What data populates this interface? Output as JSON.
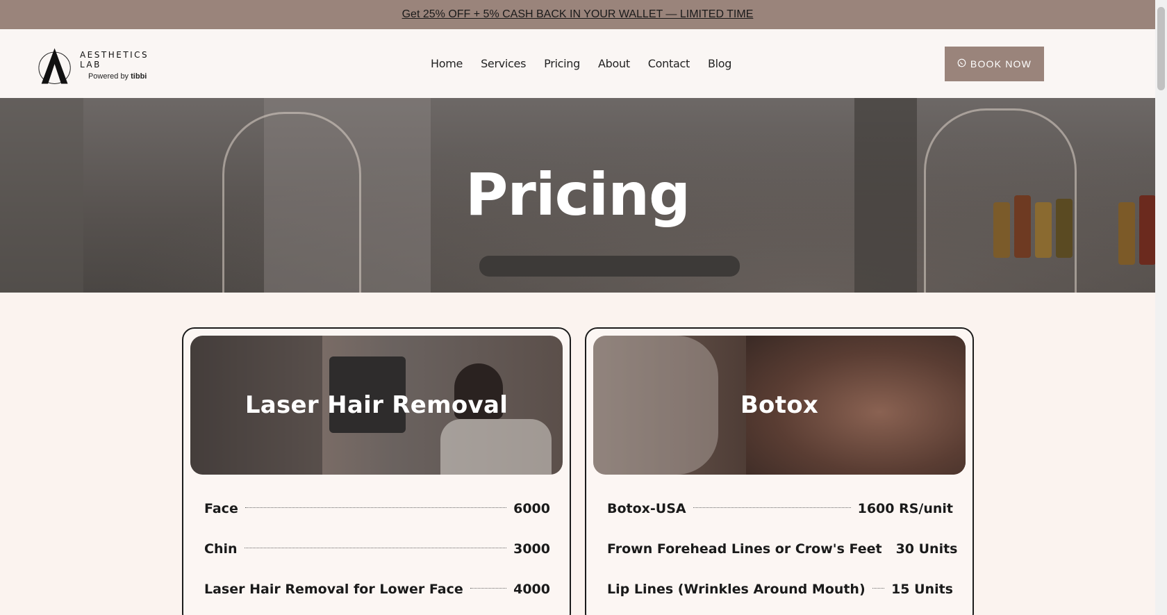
{
  "promo": {
    "text": "Get 25% OFF + 5% CASH BACK IN YOUR WALLET — LIMITED TIME"
  },
  "logo": {
    "name": "AESTHETICS LAB",
    "powered_by": "Powered by",
    "brand": "tibbi"
  },
  "nav": {
    "items": [
      {
        "label": "Home"
      },
      {
        "label": "Services"
      },
      {
        "label": "Pricing"
      },
      {
        "label": "About"
      },
      {
        "label": "Contact"
      },
      {
        "label": "Blog"
      }
    ]
  },
  "book_button": {
    "label": "BOOK NOW",
    "icon": "whatsapp-icon"
  },
  "hero": {
    "title": "Pricing"
  },
  "cards": [
    {
      "title": "Laser Hair Removal",
      "rows": [
        {
          "name": "Face",
          "price": "6000"
        },
        {
          "name": "Chin",
          "price": "3000"
        },
        {
          "name": "Laser Hair Removal for Lower Face",
          "price": "4000"
        }
      ]
    },
    {
      "title": "Botox",
      "rows": [
        {
          "name": "Botox-USA",
          "price": "1600 RS/unit"
        },
        {
          "name": "Frown Forehead Lines or Crow's Feet",
          "price": "30 Units"
        },
        {
          "name": "Lip Lines (Wrinkles Around Mouth)",
          "price": "15 Units"
        }
      ]
    }
  ],
  "colors": {
    "accent": "#9a847b",
    "background": "#fbf3ef",
    "header_bg": "#faf6f4",
    "text": "#1a1a1a"
  }
}
